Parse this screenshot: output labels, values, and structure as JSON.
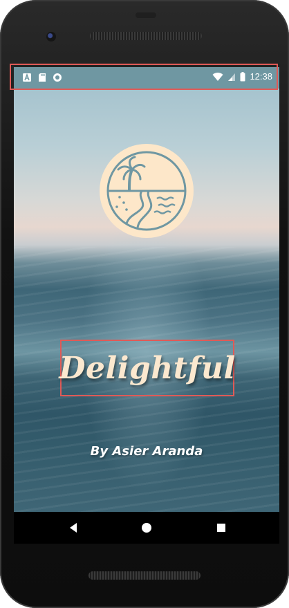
{
  "status_bar": {
    "time": "12:38",
    "left_icons": [
      "keyboard-a-icon",
      "sd-card-icon",
      "circle-record-icon"
    ],
    "right_icons": [
      "wifi-icon",
      "signal-icon",
      "battery-icon"
    ]
  },
  "splash": {
    "title": "Delightful",
    "byline": "By Asier Aranda",
    "logo": "beach-palm-logo"
  },
  "nav_bar": {
    "buttons": [
      "back-icon",
      "home-icon",
      "recents-icon"
    ]
  },
  "colors": {
    "title": "#fbe8cf",
    "logo_bg": "#fde7c9",
    "logo_stroke": "#6f97a2",
    "status_bar": "#6f97a2",
    "highlight_box": "#e05a57"
  }
}
